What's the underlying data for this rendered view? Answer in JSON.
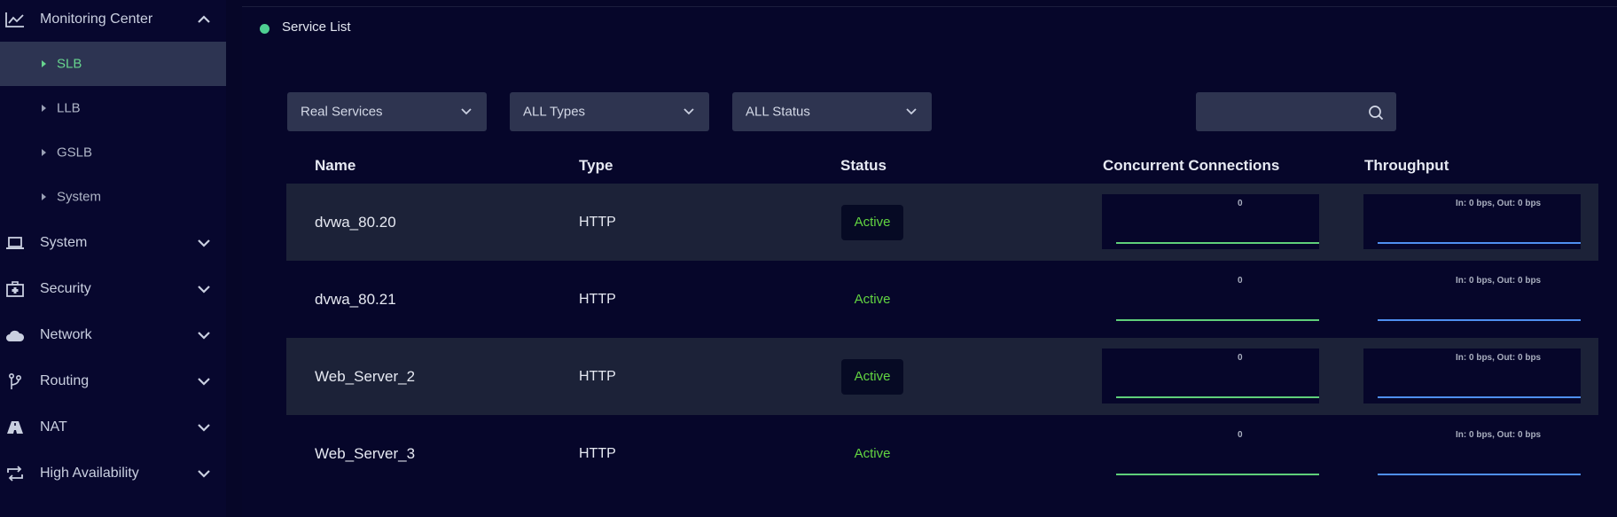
{
  "sidebar": {
    "groups": [
      {
        "label": "Monitoring Center",
        "icon": "chart-line-icon",
        "expanded": true
      },
      {
        "label": "System",
        "icon": "laptop-icon",
        "expanded": false
      },
      {
        "label": "Security",
        "icon": "first-aid-kit-icon",
        "expanded": false
      },
      {
        "label": "Network",
        "icon": "cloud-icon",
        "expanded": false
      },
      {
        "label": "Routing",
        "icon": "branch-icon",
        "expanded": false
      },
      {
        "label": "NAT",
        "icon": "road-icon",
        "expanded": false
      },
      {
        "label": "High Availability",
        "icon": "sync-icon",
        "expanded": false
      }
    ],
    "monitoring_items": [
      {
        "label": "SLB",
        "active": true
      },
      {
        "label": "LLB",
        "active": false
      },
      {
        "label": "GSLB",
        "active": false
      },
      {
        "label": "System",
        "active": false
      }
    ]
  },
  "main": {
    "title": "Service List",
    "filters": {
      "service_kind": "Real Services",
      "type": "ALL Types",
      "status": "ALL Status",
      "search_value": ""
    },
    "columns": {
      "name": "Name",
      "type": "Type",
      "status": "Status",
      "connections": "Concurrent Connections",
      "throughput": "Throughput"
    },
    "rows": [
      {
        "name": "dvwa_80.20",
        "type": "HTTP",
        "status": "Active",
        "connections": "0",
        "throughput": "In: 0 bps, Out: 0 bps"
      },
      {
        "name": "dvwa_80.21",
        "type": "HTTP",
        "status": "Active",
        "connections": "0",
        "throughput": "In: 0 bps, Out: 0 bps"
      },
      {
        "name": "Web_Server_2",
        "type": "HTTP",
        "status": "Active",
        "connections": "0",
        "throughput": "In: 0 bps, Out: 0 bps"
      },
      {
        "name": "Web_Server_3",
        "type": "HTTP",
        "status": "Active",
        "connections": "0",
        "throughput": "In: 0 bps, Out: 0 bps"
      }
    ]
  },
  "colors": {
    "accent_green": "#67d48e",
    "status_active": "#62d441",
    "connections_line": "#5fcf7a",
    "throughput_line": "#4f8ff0",
    "sidebar_active_bg": "#2d3452"
  }
}
